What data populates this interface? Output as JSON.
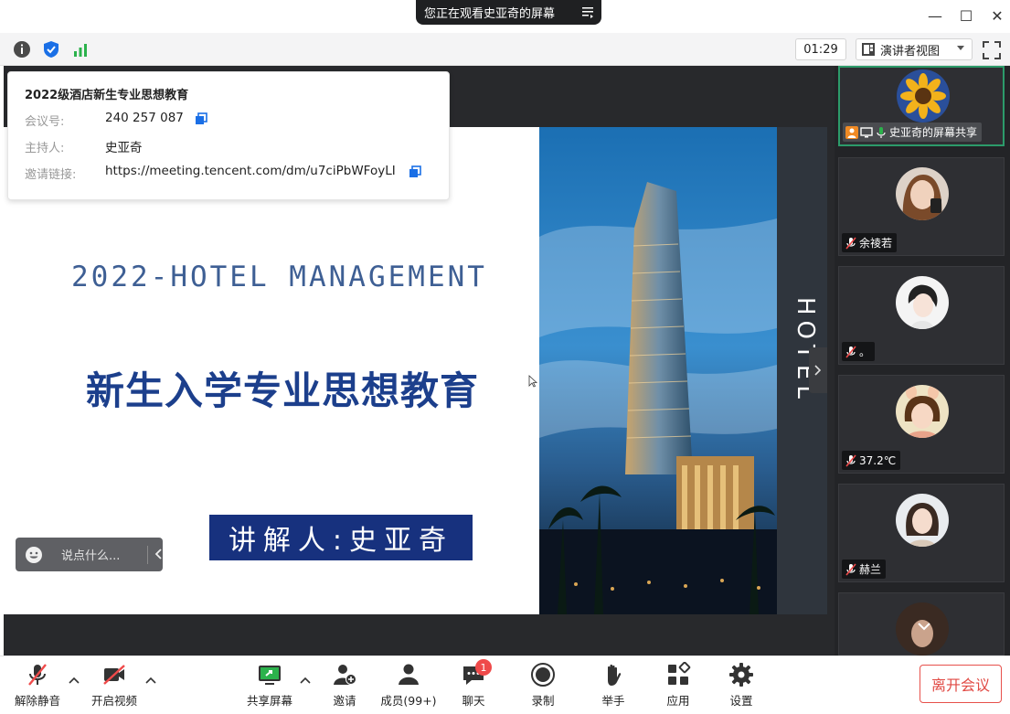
{
  "window": {
    "share_banner": "您正在观看史亚奇的屏幕",
    "minimize_glyph": "—",
    "maximize_glyph": "☐",
    "close_glyph": "✕"
  },
  "toolbar": {
    "timer": "01:29",
    "view_mode": "演讲者视图",
    "icons": [
      "info-icon",
      "shield-icon",
      "signal-icon",
      "fullscreen-icon"
    ]
  },
  "meeting_info": {
    "title": "2022级酒店新生专业思想教育",
    "id_label": "会议号:",
    "id_value": "240 257 087",
    "host_label": "主持人:",
    "host_value": "史亚奇",
    "link_label": "邀请链接:",
    "link_value": "https://meeting.tencent.com/dm/u7ciPbWFoyLI"
  },
  "slide": {
    "heading_en": "2022-HOTEL MANAGEMENT",
    "heading_zh": "新生入学专业思想教育",
    "speaker": "讲解人:史亚奇",
    "side_text": "HOTEL"
  },
  "chat": {
    "placeholder": "说点什么..."
  },
  "participants": [
    {
      "name": "史亚奇的屏幕共享",
      "active": true
    },
    {
      "name": "余祾若",
      "active": false
    },
    {
      "name": "。",
      "active": false
    },
    {
      "name": "37.2℃",
      "active": false
    },
    {
      "name": "赫兰",
      "active": false
    },
    {
      "name": "",
      "active": false
    }
  ],
  "bottom_bar": {
    "mute": "解除静音",
    "video": "开启视频",
    "share": "共享屏幕",
    "invite": "邀请",
    "members": "成员(99+)",
    "chat": "聊天",
    "chat_badge": "1",
    "record": "录制",
    "raise_hand": "举手",
    "apps": "应用",
    "settings": "设置",
    "leave": "离开会议"
  },
  "colors": {
    "accent_blue": "#1a6fe6",
    "slide_navy": "#17317e",
    "active_green": "#2c9b6a",
    "leave_red": "#e14a44"
  }
}
